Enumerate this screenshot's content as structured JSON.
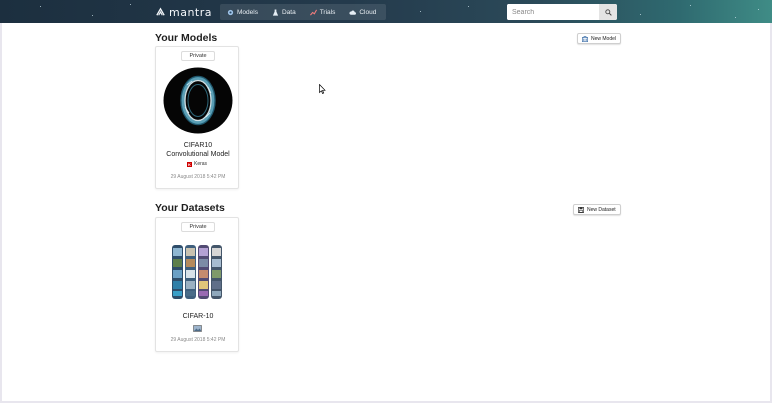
{
  "app": {
    "logo_text": "mantra"
  },
  "nav": {
    "tabs": [
      {
        "label": "Models",
        "icon": "models-icon"
      },
      {
        "label": "Data",
        "icon": "data-icon"
      },
      {
        "label": "Trials",
        "icon": "trials-icon"
      },
      {
        "label": "Cloud",
        "icon": "cloud-icon"
      }
    ],
    "search_placeholder": "Search"
  },
  "models": {
    "title": "Your Models",
    "new_button": "New Model",
    "cards": [
      {
        "badge": "Private",
        "name_line1": "CIFAR10",
        "name_line2": "Convolutional Model",
        "framework": "Keras",
        "framework_icon_letter": "K",
        "date": "29 August 2018 5:42 PM"
      }
    ]
  },
  "datasets": {
    "title": "Your Datasets",
    "new_button": "New Dataset",
    "cards": [
      {
        "badge": "Private",
        "name": "CIFAR-10",
        "date": "29 August 2018 5:42 PM"
      }
    ]
  },
  "colors": {
    "navbar_start": "#1c2f3f",
    "navbar_end": "#3f8c86",
    "keras_red": "#d00000"
  }
}
